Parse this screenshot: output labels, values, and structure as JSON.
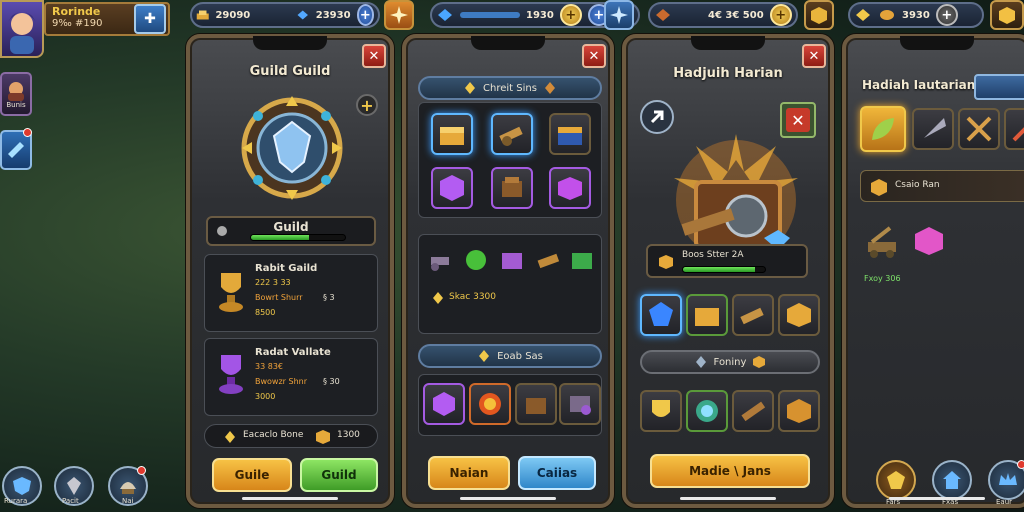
{
  "profile": {
    "name": "Rorinde",
    "level": "9‰ #190"
  },
  "topbar": {
    "res1": "29090",
    "res2": "23930",
    "res3": "1930",
    "res4": "4€ 3€ 500",
    "res5": "3930"
  },
  "leftnav": {
    "item1_label": "Bunis"
  },
  "bottomnav": {
    "item1": "Rurara",
    "item2": "Pacit",
    "item3": "Nai"
  },
  "panel1": {
    "title": "Guild Guild",
    "guild_bar_label": "Guild",
    "card1": {
      "title": "Rabit Gaild",
      "line1": "222 3 33",
      "line2": "Bowrt Shurr",
      "line2b": "§ 3",
      "line3": "8500"
    },
    "card2": {
      "title": "Radat Vallate",
      "line1": "33 83€",
      "line2": "Bwowzr Shnr",
      "line2b": "§ 30",
      "line3": "3000"
    },
    "footer": {
      "label": "Eacaclo Bone",
      "value": "1300"
    },
    "btn_left": "Guile",
    "btn_right": "Guild"
  },
  "panel2": {
    "header_label": "Chreit Sins",
    "mid_label": "Skac 3300",
    "section2_label": "Eoab Sas",
    "btn_left": "Naian",
    "btn_right": "Caiias"
  },
  "panel3": {
    "title": "Hadjuih Harian",
    "status_label": "Boos Stter 2A",
    "strip_label": "Foniny",
    "btn": "Madie \\ Jans"
  },
  "panel4": {
    "title": "Hadiah Iautarian",
    "item_label": "Csaio Ran",
    "small_label": "Fxoy 306",
    "nav1": "Fars",
    "nav2": "Fxas",
    "nav3": "Eaur"
  },
  "colors": {
    "accent_gold": "#f0c84a",
    "panel_border": "#6d5a40",
    "progress": "#4bc83a",
    "close": "#c5352b"
  }
}
